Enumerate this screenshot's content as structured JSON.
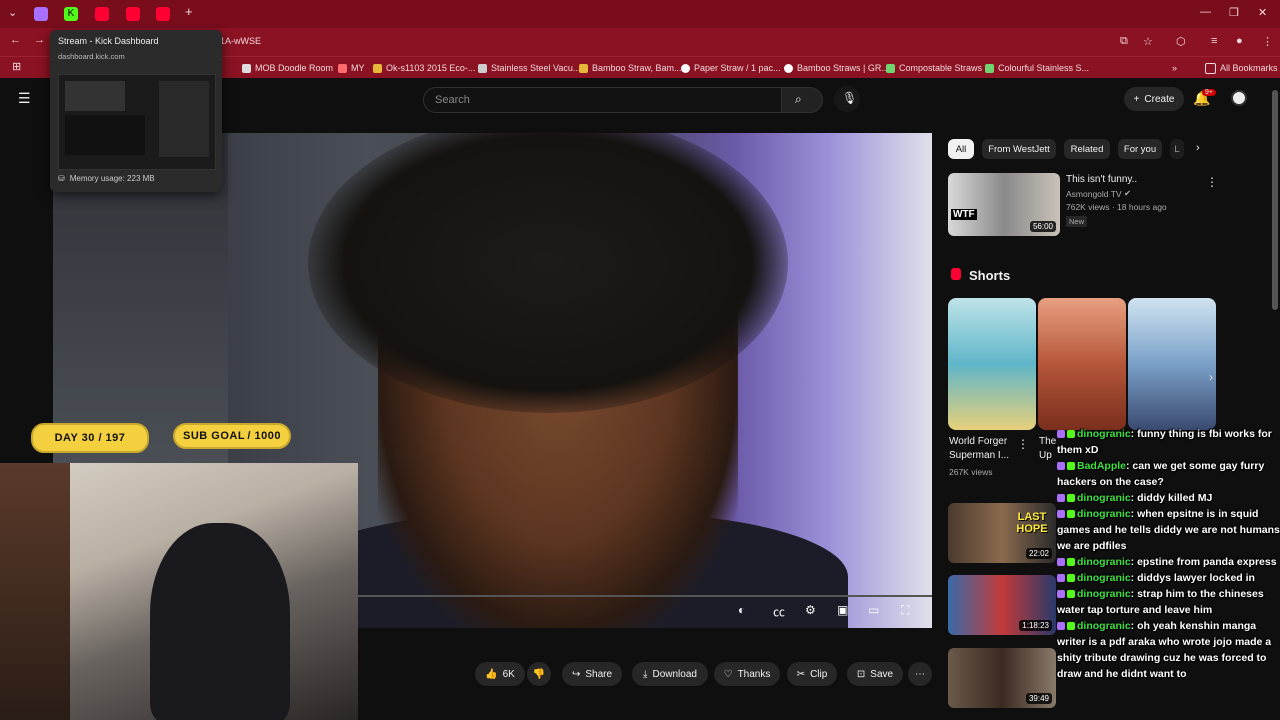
{
  "browser": {
    "tabs": [
      {
        "icon": "twitch-icon",
        "color": "#a970ff"
      },
      {
        "icon": "kick-icon",
        "color": "#53fc18"
      },
      {
        "icon": "youtube-icon",
        "color": "#ff0033"
      },
      {
        "icon": "youtube-icon",
        "color": "#ff0033"
      },
      {
        "icon": "youtube-icon",
        "color": "#ff0033"
      }
    ],
    "new_tab_label": "+",
    "url_fragment": "1A-wWSE",
    "bookmarks": [
      "MOB Doodle Room",
      "MY",
      "Ok-s1103 2015 Eco-...",
      "Stainless Steel Vacu...",
      "Bamboo Straw, Bam...",
      "Paper Straw / 1 pac...",
      "Bamboo Straws | GR...",
      "Compostable Straws",
      "Colourful Stainless S..."
    ],
    "all_bookmarks": "All Bookmarks",
    "tooltip": {
      "title": "Stream - Kick Dashboard",
      "domain": "dashboard.kick.com",
      "memory": "Memory usage: 223 MB"
    }
  },
  "youtube": {
    "search_placeholder": "Search",
    "create_label": "Create",
    "notif_count": "9+",
    "actions": {
      "likes": "6K",
      "share": "Share",
      "download": "Download",
      "thanks": "Thanks",
      "clip": "Clip",
      "save": "Save",
      "more": "⋯"
    },
    "chips": [
      "All",
      "From WestJett",
      "Related",
      "For you",
      "L"
    ],
    "recommended": {
      "title": "This isn't funny..",
      "channel": "Asmongold TV",
      "meta": "762K views · 18 hours ago",
      "badge": "New",
      "duration": "56:00",
      "thumb_text": "WTF"
    },
    "shorts_label": "Shorts",
    "shorts": [
      {
        "title_line1": "World Forger",
        "title_line2": "Superman I...",
        "views": "267K views"
      },
      {
        "title_line1": "The",
        "title_line2": "Up"
      }
    ],
    "small_recs": [
      {
        "thumb_text": "LAST HOPE",
        "duration": "22:02"
      },
      {
        "thumb_text": "",
        "duration": "1:18:23"
      },
      {
        "thumb_text": "",
        "duration": "39:49"
      }
    ]
  },
  "stream_overlay": {
    "day_counter": "DAY  30 / 197",
    "sub_goal_label": "SUB GOAL",
    "sub_goal_value": "/ 1000"
  },
  "chat": [
    {
      "user": "dinogranic",
      "text": ": funny thing is fbi works for them xD",
      "color": "#3fe13f"
    },
    {
      "user": "BadApple",
      "text": ": can we get some gay furry hackers on the case?",
      "color": "#3fe13f"
    },
    {
      "user": "dinogranic",
      "text": ": diddy killed MJ",
      "color": "#3fe13f"
    },
    {
      "user": "dinogranic",
      "text": ": when epsitne is in squid games and he tells diddy we are not humans we are pdfiles",
      "color": "#3fe13f"
    },
    {
      "user": "dinogranic",
      "text": ": epstine from panda express",
      "color": "#3fe13f"
    },
    {
      "user": "dinogranic",
      "text": ": diddys lawyer locked in",
      "color": "#3fe13f"
    },
    {
      "user": "dinogranic",
      "text": ": strap him to the chineses water tap torture and leave him",
      "color": "#3fe13f"
    },
    {
      "user": "dinogranic",
      "text": ": oh yeah kenshin manga writer is a pdf araka who wrote jojo made a shity tribute drawing cuz he was forced to draw and he didnt want to",
      "color": "#3fe13f"
    }
  ]
}
